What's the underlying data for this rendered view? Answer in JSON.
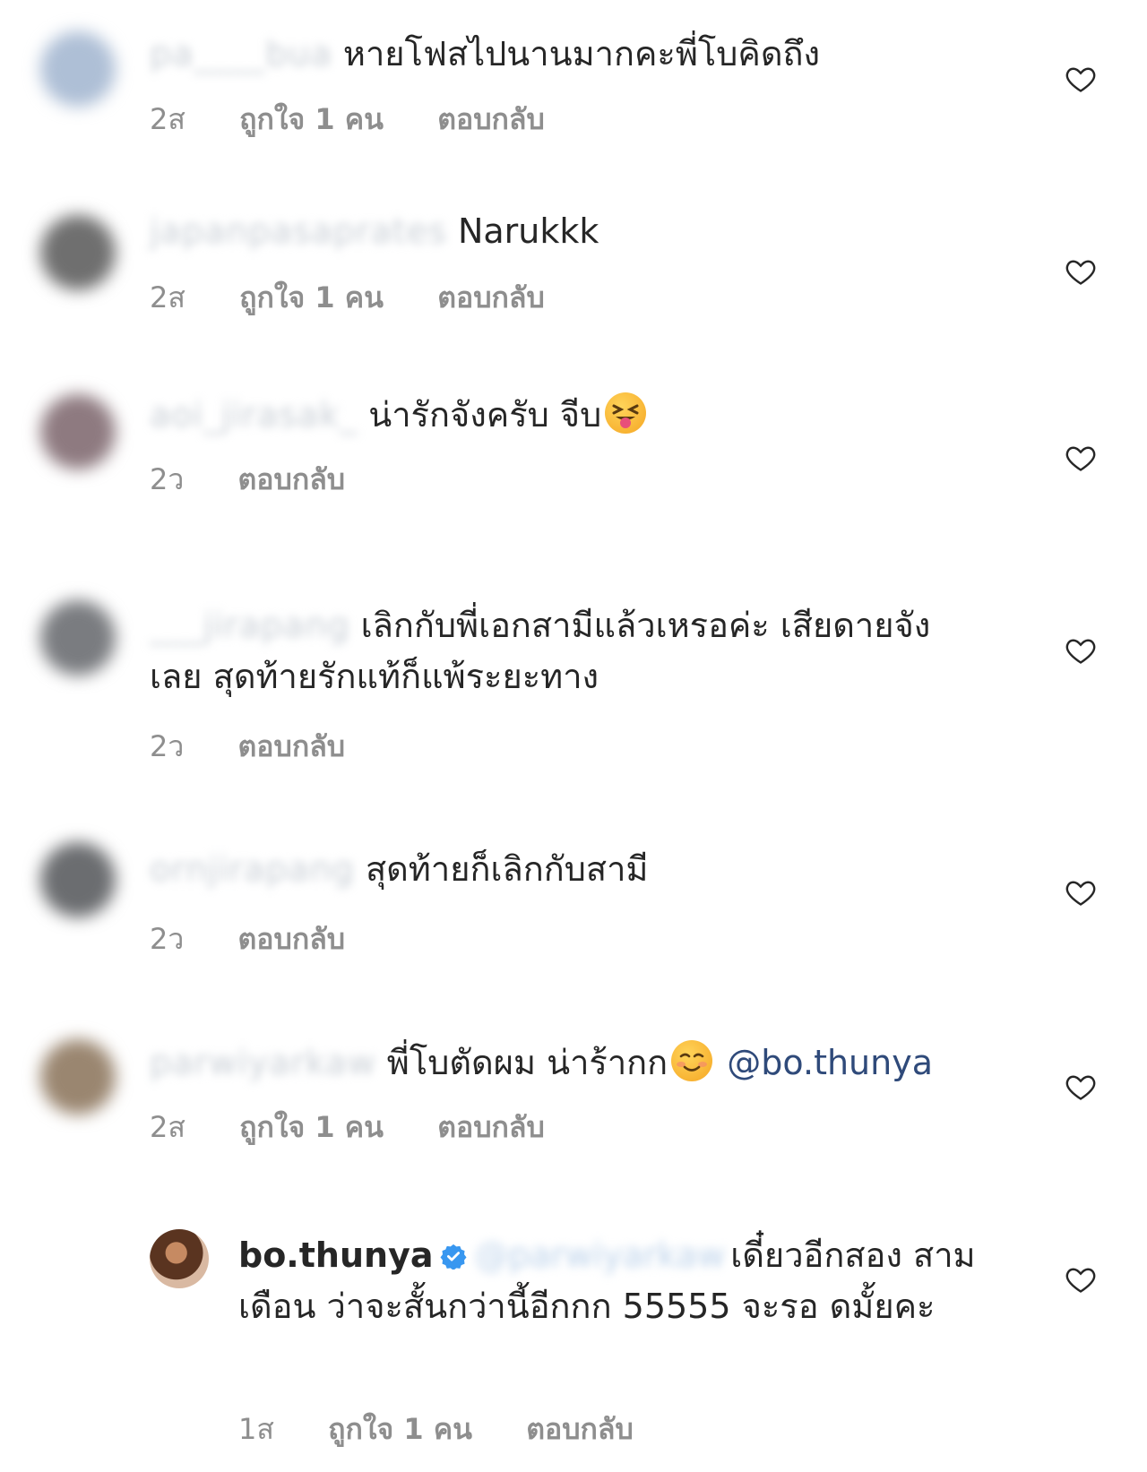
{
  "comments": [
    {
      "username": "pa____bua",
      "text": "หายโฟสไปนานมากคะพี่โบคิดถึง",
      "time": "2ส",
      "likes": "ถูกใจ 1 คน",
      "reply": "ตอบกลับ",
      "avatar_color": "#aebfd6"
    },
    {
      "username": "japanpasaprates",
      "text": "Narukkk",
      "time": "2ส",
      "likes": "ถูกใจ 1 คน",
      "reply": "ตอบกลับ",
      "avatar_color": "#6f6f6f"
    },
    {
      "username": "aoi_jirasak_",
      "text": "น่ารักจังครับ จีบ",
      "emoji": "squinting-face-with-tongue",
      "time": "2ว",
      "reply": "ตอบกลับ",
      "avatar_color": "#8e7a80"
    },
    {
      "username": "___jirapang",
      "text": "เลิกกับพี่เอกสามีแล้วเหรอค่ะ เสียดายจัง เลย สุดท้ายรักแท้ก็แพ้ระยะทาง",
      "time": "2ว",
      "reply": "ตอบกลับ",
      "avatar_color": "#7a7c80"
    },
    {
      "username": "ornjirapang",
      "text": "สุดท้ายก็เลิกกับสามี",
      "time": "2ว",
      "reply": "ตอบกลับ",
      "avatar_color": "#6b6d70"
    },
    {
      "username": "parwiyarkaw",
      "text": "พี่โบตัดผม น่าร้ากก",
      "emoji": "smiling-face",
      "mention": "@bo.thunya",
      "time": "2ส",
      "likes": "ถูกใจ 1 คน",
      "reply": "ตอบกลับ",
      "avatar_color": "#9a8670"
    }
  ],
  "owner_reply": {
    "username": "bo.thunya",
    "verified": true,
    "blurred_mention": "@parwiyarkaw",
    "text": "เดี๋ยวอีกสอง สามเดือน ว่าจะสั้นกว่านี้อีกกก 55555 จะรอ ดมั้ยคะ",
    "time": "1ส",
    "likes": "ถูกใจ 1 คน",
    "reply": "ตอบกลับ"
  },
  "icons": {
    "like": "heart-outline-icon",
    "verified": "verified-badge-icon"
  },
  "colors": {
    "text": "#262626",
    "meta": "#8e8e8e",
    "mention": "#2f4a7a",
    "verified": "#3897f0"
  }
}
